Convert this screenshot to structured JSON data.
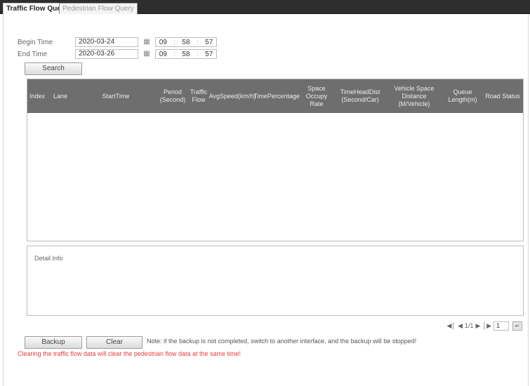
{
  "tabs": {
    "traffic": "Traffic Flow Query",
    "pedestrian": "Pedestrian Flow Query"
  },
  "query": {
    "begin_label": "Begin Time",
    "begin_date": "2020-03-24",
    "begin_hh": "09",
    "begin_mm": "58",
    "begin_ss": "57",
    "end_label": "End Time",
    "end_date": "2020-03-26",
    "end_hh": "09",
    "end_mm": "58",
    "end_ss": "57",
    "search_label": "Search"
  },
  "table": {
    "columns": [
      "Index",
      "Lane",
      "StartTime",
      "Period (Second)",
      "Traffic Flow",
      "AvgSpeed(km/h)",
      "TimePercentage",
      "Space Occupy Rate",
      "TimeHeadDist (Second/Car)",
      "Vehicle Space Distance (M/Vehicle)",
      "Queue Length(m)",
      "Road Status"
    ]
  },
  "detail": {
    "title": "Detail Info"
  },
  "pager": {
    "page_text": "1/1",
    "page_input": "1"
  },
  "actions": {
    "backup_label": "Backup",
    "clear_label": "Clear",
    "note": "Note: if the backup is not completed, switch to another interface, and the backup will be stopped!",
    "warning": "Clearing the traffic flow data will clear the pedestrian flow data at the same time!"
  },
  "colors": {
    "header_bg": "#6e6e6e",
    "tabbar_bg": "#2e2e2e",
    "warning": "#e83b3b"
  },
  "icons": {
    "calendar": "calendar-icon",
    "first_page": "first-page-icon",
    "prev_page": "prev-page-icon",
    "next_page": "next-page-icon",
    "last_page": "last-page-icon",
    "go": "go-icon"
  }
}
